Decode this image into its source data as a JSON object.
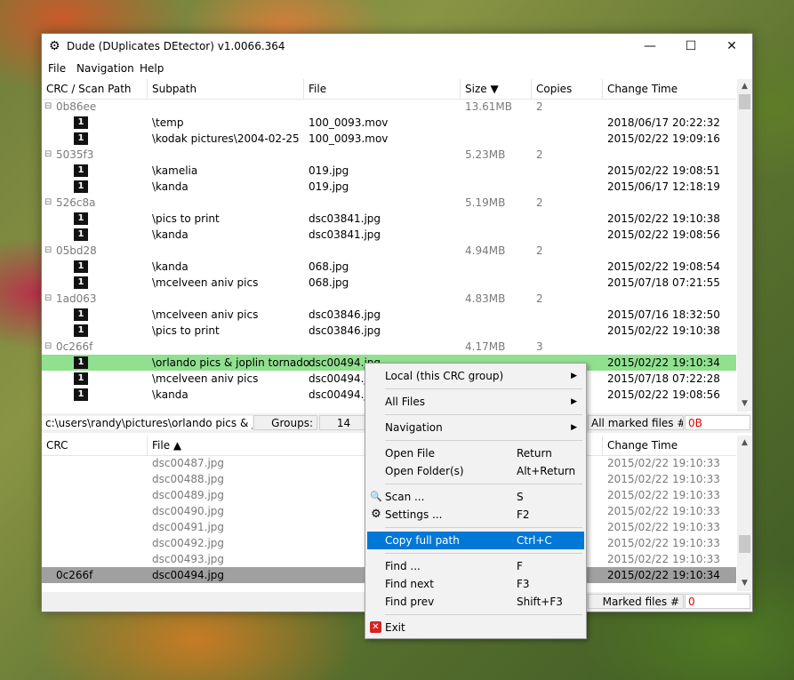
{
  "window": {
    "title": "Dude (DUplicates DEtector) v1.0066.364",
    "app_icon": "⚙",
    "min": "—",
    "max": "☐",
    "close": "✕"
  },
  "menubar": {
    "file": "File",
    "navigation": "Navigation",
    "help": "Help"
  },
  "top_table": {
    "headers": {
      "crc": "CRC / Scan Path",
      "subpath": "Subpath",
      "file": "File",
      "size": "Size ▼",
      "copies": "Copies",
      "time": "Change Time"
    },
    "expander": "⊟",
    "badge": "1",
    "rows": [
      {
        "type": "group",
        "crc": "0b86ee",
        "size": "13.61MB",
        "copies": "2"
      },
      {
        "type": "file",
        "subpath": "\\temp",
        "file": "100_0093.mov",
        "time": "2018/06/17 20:22:32"
      },
      {
        "type": "file",
        "subpath": "\\kodak pictures\\2004-02-25",
        "file": "100_0093.mov",
        "time": "2015/02/22 19:09:16"
      },
      {
        "type": "group",
        "crc": "5035f3",
        "size": "5.23MB",
        "copies": "2"
      },
      {
        "type": "file",
        "subpath": "\\kamelia",
        "file": "019.jpg",
        "time": "2015/02/22 19:08:51"
      },
      {
        "type": "file",
        "subpath": "\\kanda",
        "file": "019.jpg",
        "time": "2015/06/17 12:18:19"
      },
      {
        "type": "group",
        "crc": "526c8a",
        "size": "5.19MB",
        "copies": "2"
      },
      {
        "type": "file",
        "subpath": "\\pics to print",
        "file": "dsc03841.jpg",
        "time": "2015/02/22 19:10:38"
      },
      {
        "type": "file",
        "subpath": "\\kanda",
        "file": "dsc03841.jpg",
        "time": "2015/02/22 19:08:56"
      },
      {
        "type": "group",
        "crc": "05bd28",
        "size": "4.94MB",
        "copies": "2"
      },
      {
        "type": "file",
        "subpath": "\\kanda",
        "file": "068.jpg",
        "time": "2015/02/22 19:08:54"
      },
      {
        "type": "file",
        "subpath": "\\mcelveen aniv pics",
        "file": "068.jpg",
        "time": "2015/07/18 07:21:55"
      },
      {
        "type": "group",
        "crc": "1ad063",
        "size": "4.83MB",
        "copies": "2"
      },
      {
        "type": "file",
        "subpath": "\\mcelveen aniv pics",
        "file": "dsc03846.jpg",
        "time": "2015/07/16 18:32:50"
      },
      {
        "type": "file",
        "subpath": "\\pics to print",
        "file": "dsc03846.jpg",
        "time": "2015/02/22 19:10:38"
      },
      {
        "type": "group",
        "crc": "0c266f",
        "size": "4.17MB",
        "copies": "3"
      },
      {
        "type": "file",
        "selected": true,
        "subpath": "\\orlando pics & joplin tornado",
        "file": "dsc00494.jpg",
        "time": "2015/02/22 19:10:34"
      },
      {
        "type": "file",
        "subpath": "\\mcelveen aniv pics",
        "file": "dsc00494.jpg",
        "time": "2015/07/18 07:22:28"
      },
      {
        "type": "file",
        "subpath": "\\kanda",
        "file": "dsc00494.jpg",
        "time": "2015/02/22 19:08:56"
      }
    ]
  },
  "status_top": {
    "path": "c:\\users\\randy\\pictures\\orlando pics & joplin tornado",
    "groups_label": "Groups:",
    "groups_value": "14",
    "marked_label": "All marked files #",
    "marked_value": "0B"
  },
  "bottom_table": {
    "headers": {
      "crc": "CRC",
      "file": "File ▲",
      "time": "Change Time"
    },
    "rows": [
      {
        "crc": "",
        "file": "dsc00487.jpg",
        "time": "2015/02/22 19:10:33",
        "dim": true
      },
      {
        "crc": "",
        "file": "dsc00488.jpg",
        "time": "2015/02/22 19:10:33",
        "dim": true
      },
      {
        "crc": "",
        "file": "dsc00489.jpg",
        "time": "2015/02/22 19:10:33",
        "dim": true
      },
      {
        "crc": "",
        "file": "dsc00490.jpg",
        "time": "2015/02/22 19:10:33",
        "dim": true
      },
      {
        "crc": "",
        "file": "dsc00491.jpg",
        "time": "2015/02/22 19:10:33",
        "dim": true
      },
      {
        "crc": "",
        "file": "dsc00492.jpg",
        "time": "2015/02/22 19:10:33",
        "dim": true
      },
      {
        "crc": "",
        "file": "dsc00493.jpg",
        "time": "2015/02/22 19:10:33",
        "dim": true
      },
      {
        "crc": "0c266f",
        "file": "dsc00494.jpg",
        "time": "2015/02/22 19:10:34",
        "selected": true
      }
    ]
  },
  "status_bottom": {
    "marked_label": "Marked files #",
    "marked_value": "0"
  },
  "context_menu": {
    "local": "Local (this CRC group)",
    "all_files": "All Files",
    "navigation": "Navigation",
    "open_file": "Open File",
    "open_file_sc": "Return",
    "open_folder": "Open Folder(s)",
    "open_folder_sc": "Alt+Return",
    "scan": "Scan ...",
    "scan_sc": "S",
    "settings": "Settings ...",
    "settings_sc": "F2",
    "copy_path": "Copy full path",
    "copy_path_sc": "Ctrl+C",
    "find": "Find ...",
    "find_sc": "F",
    "find_next": "Find next",
    "find_next_sc": "F3",
    "find_prev": "Find prev",
    "find_prev_sc": "Shift+F3",
    "exit": "Exit",
    "submenu_arrow": "▶",
    "scan_icon": "🔍",
    "settings_icon": "⚙",
    "exit_icon": "✕"
  },
  "scroll": {
    "up": "▲",
    "down": "▼"
  }
}
